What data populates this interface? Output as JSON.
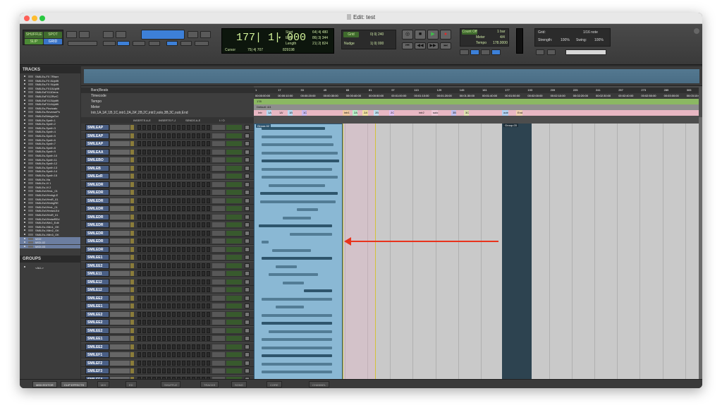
{
  "window": {
    "title": "Edit: test"
  },
  "toolbar": {
    "modes": [
      "SHUFFLE",
      "SPOT",
      "SLIP",
      "GRID"
    ],
    "counter_main": "177| 1| 000",
    "counter_arrow": "▾",
    "start_label": "Start",
    "start_value": "64| 4| 480",
    "end_label": "End",
    "end_value": "86| 3| 344",
    "length_label": "Length",
    "length_value": "21| 2| 824",
    "cursor_label": "Cursor",
    "cursor_value": "75| 4| 707",
    "cursor_extra": "829198",
    "grid_label": "Grid",
    "grid_value": "0| 0| 240",
    "nudge_label": "Nudge",
    "nudge_value": "1| 0| 000",
    "count_off": "Count Off",
    "count_off_value": "1 bar",
    "meter_label": "Meter",
    "meter_value": "4/4",
    "tempo_label": "Tempo",
    "tempo_value": "178.0000",
    "grid2_label": "Grid:",
    "grid2_value": "1/16 note",
    "strength_label": "Strength:",
    "strength_value": "100%",
    "swing_label": "Swing:",
    "swing_value": "100%"
  },
  "left_panel": {
    "tracks_header": "TRACKS",
    "tracks": [
      "SMILEs-FX 7Riser",
      "SMILEs-FX 8Uplift",
      "SMILEs-FX 9Uplift",
      "SMILEs-FX10Uplift",
      "SMILEsFX11Dens",
      "SMILEsFX12RvrC",
      "SMILEsFX13Uplift",
      "SMILEsFX14Uplift",
      "SMILEs-Pizzicato",
      "SMILEs-ReversePn",
      "SMILEsStringsOct",
      "SMILEs-Synth 1",
      "SMILEs-Synth 2",
      "SMILEs-Synth 3",
      "SMILEs-Synth 4",
      "SMILEs-Synth 5",
      "SMILEs-Synth 6",
      "SMILEs-Synth 7",
      "SMILEs-Synth 8",
      "SMILEs-Synth 9",
      "SMILEs-Synth 10",
      "SMILEs-Synth 11",
      "SMILEs-Synth 12",
      "SMILEs-Synth 13",
      "SMILEs-Synth 14",
      "SMILEs-Synth 15",
      "SMILEs-Vla",
      "SMILEs-Vl 1",
      "SMILEs-Vl 2",
      "SMILEsVHmL_01",
      "SMILEsVHmhgLE",
      "SMILEsVHmR_01",
      "SMILEsVHmhgRE",
      "SMILEsVHmL_01",
      "SMILEsVHmlwLEd",
      "SMILEsVHmR_01",
      "SMILEsVHmlwREd",
      "SMILEsVMn1_Edit",
      "SMILEs-VMn1_OK",
      "SMILEs-VMn2_OK",
      "SMILEs-VMn3_OK",
      "MIDI",
      "MIDI-02",
      "MIDI-03"
    ],
    "groups_header": "GROUPS",
    "groups_item": "<ALL>"
  },
  "rulers": {
    "bars_beats": "Bars|Beats",
    "timecode": "Timecode",
    "tempo": "Tempo",
    "meter": "Meter",
    "markers": [
      "Intr",
      "1A",
      "1A'",
      "1B",
      "1C",
      "intr1",
      "2A",
      "2A'",
      "2B",
      "2C",
      "intr2",
      "solo",
      "3B",
      "3C",
      "outr",
      "End"
    ],
    "tempo_value": "178",
    "meter_value": "Default: 4/4",
    "bar_numbers": [
      "1",
      "17",
      "33",
      "49",
      "65",
      "81",
      "97",
      "113",
      "129",
      "145",
      "161",
      "177",
      "193",
      "209",
      "225",
      "241",
      "257",
      "273",
      "289",
      "305"
    ],
    "timecodes": [
      "00:00:00:00",
      "00:00:10:00",
      "00:00:20:00",
      "00:00:30:00",
      "00:00:40:00",
      "00:00:50:00",
      "00:01:00:00",
      "00:01:10:00",
      "00:01:20:00",
      "00:01:30:00",
      "00:01:40:00",
      "00:01:50:00",
      "00:02:00:00",
      "00:02:10:00",
      "00:02:20:00",
      "00:02:30:00",
      "00:02:40:00",
      "00:02:50:00",
      "00:03:00:00",
      "00:03:10:00"
    ]
  },
  "columns": {
    "inserts_ae": "INSERTS A-E",
    "inserts_fj": "INSERTS F-J",
    "sends_ae": "SENDS A-E",
    "io": "I / O"
  },
  "track_rows": [
    "SMILEAP",
    "SMILEAP",
    "SMILEAP",
    "SMILEAA",
    "SMILEBO",
    "SMILEB",
    "SMILEeR",
    "SMILEDR",
    "SMILEDR",
    "SMILEDR",
    "SMILEDR",
    "SMILEDR",
    "SMILEDR",
    "SMILEDR",
    "SMILEDR",
    "SMILEDR",
    "SMILEE1",
    "SMILEE2",
    "SMILE11",
    "SMILE12",
    "SMILE12",
    "SMILEE2",
    "SMILEE1",
    "SMILEE2",
    "SMILEE2",
    "SMILEE2",
    "SMILEE1",
    "SMILEE2",
    "SMILEF1",
    "SMILEF2",
    "SMILEF3",
    "SMILEF4"
  ],
  "clips": {
    "group_label_1": "Group-02",
    "group_label_2": "Group-03"
  },
  "bottom_tabs": [
    "MIDI EDITOR",
    "CLIP EFFECTS",
    "MIX",
    "ED",
    "SHUFFLE",
    "TRACKS",
    "SONG",
    "CORE",
    "CHANNEL"
  ],
  "colors": {
    "accent": "#e8331c",
    "clip": "#8ab8d4",
    "waveform": "#244a60",
    "track_name": "#4a5f85"
  }
}
